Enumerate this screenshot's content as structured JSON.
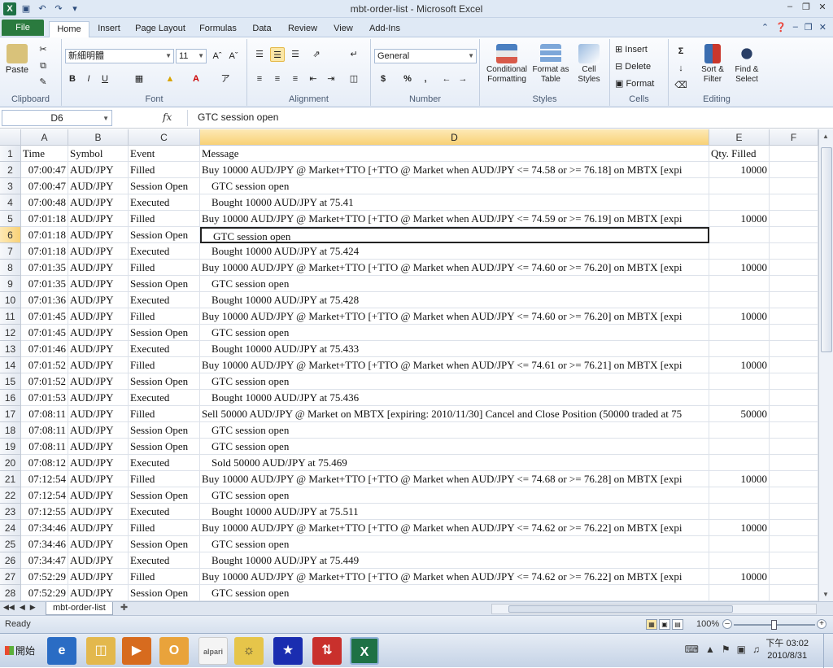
{
  "window": {
    "title": "mbt-order-list - Microsoft Excel"
  },
  "ribbon_tabs": [
    "File",
    "Home",
    "Insert",
    "Page Layout",
    "Formulas",
    "Data",
    "Review",
    "View",
    "Add-Ins"
  ],
  "ribbon": {
    "clipboard": {
      "paste": "Paste",
      "group": "Clipboard"
    },
    "font": {
      "name": "新細明體",
      "size": "11",
      "group": "Font",
      "bold": "B",
      "italic": "I",
      "underline": "U"
    },
    "alignment": {
      "group": "Alignment"
    },
    "number": {
      "format": "General",
      "group": "Number",
      "currency": "$",
      "percent": "%",
      "comma": ","
    },
    "styles": {
      "conditional": "Conditional Formatting",
      "format_table": "Format as Table",
      "cell_styles": "Cell Styles",
      "group": "Styles"
    },
    "cells": {
      "insert": "Insert",
      "delete": "Delete",
      "format": "Format",
      "group": "Cells"
    },
    "editing": {
      "sort": "Sort & Filter",
      "find": "Find & Select",
      "group": "Editing"
    }
  },
  "formula_bar": {
    "name_box": "D6",
    "fx": "fx",
    "formula": "GTC session open"
  },
  "columns": [
    "A",
    "B",
    "C",
    "D",
    "E",
    "F"
  ],
  "rows": [
    {
      "n": "1",
      "a": "Time",
      "b": "Symbol",
      "c": "Event",
      "d": "Message",
      "e": "Qty. Filled",
      "header": true
    },
    {
      "n": "2",
      "a": "07:00:47",
      "b": "AUD/JPY",
      "c": "Filled",
      "d": "Buy 10000 AUD/JPY @ Market+TTO [+TTO @ Market when AUD/JPY <= 74.58 or >= 76.18] on MBTX [expi",
      "e": "10000"
    },
    {
      "n": "3",
      "a": "07:00:47",
      "b": "AUD/JPY",
      "c": "Session Open",
      "d": "GTC session open",
      "e": "",
      "indent": true
    },
    {
      "n": "4",
      "a": "07:00:48",
      "b": "AUD/JPY",
      "c": "Executed",
      "d": "Bought 10000 AUD/JPY at 75.41",
      "e": "",
      "indent": true
    },
    {
      "n": "5",
      "a": "07:01:18",
      "b": "AUD/JPY",
      "c": "Filled",
      "d": "Buy 10000 AUD/JPY @ Market+TTO [+TTO @ Market when AUD/JPY <= 74.59 or >= 76.19] on MBTX [expi",
      "e": "10000"
    },
    {
      "n": "6",
      "a": "07:01:18",
      "b": "AUD/JPY",
      "c": "Session Open",
      "d": "GTC session open",
      "e": "",
      "indent": true,
      "active": true
    },
    {
      "n": "7",
      "a": "07:01:18",
      "b": "AUD/JPY",
      "c": "Executed",
      "d": "Bought 10000 AUD/JPY at 75.424",
      "e": "",
      "indent": true
    },
    {
      "n": "8",
      "a": "07:01:35",
      "b": "AUD/JPY",
      "c": "Filled",
      "d": "Buy 10000 AUD/JPY @ Market+TTO [+TTO @ Market when AUD/JPY <= 74.60 or >= 76.20] on MBTX [expi",
      "e": "10000"
    },
    {
      "n": "9",
      "a": "07:01:35",
      "b": "AUD/JPY",
      "c": "Session Open",
      "d": "GTC session open",
      "e": "",
      "indent": true
    },
    {
      "n": "10",
      "a": "07:01:36",
      "b": "AUD/JPY",
      "c": "Executed",
      "d": "Bought 10000 AUD/JPY at 75.428",
      "e": "",
      "indent": true
    },
    {
      "n": "11",
      "a": "07:01:45",
      "b": "AUD/JPY",
      "c": "Filled",
      "d": "Buy 10000 AUD/JPY @ Market+TTO [+TTO @ Market when AUD/JPY <= 74.60 or >= 76.20] on MBTX [expi",
      "e": "10000"
    },
    {
      "n": "12",
      "a": "07:01:45",
      "b": "AUD/JPY",
      "c": "Session Open",
      "d": "GTC session open",
      "e": "",
      "indent": true
    },
    {
      "n": "13",
      "a": "07:01:46",
      "b": "AUD/JPY",
      "c": "Executed",
      "d": "Bought 10000 AUD/JPY at 75.433",
      "e": "",
      "indent": true
    },
    {
      "n": "14",
      "a": "07:01:52",
      "b": "AUD/JPY",
      "c": "Filled",
      "d": "Buy 10000 AUD/JPY @ Market+TTO [+TTO @ Market when AUD/JPY <= 74.61 or >= 76.21] on MBTX [expi",
      "e": "10000"
    },
    {
      "n": "15",
      "a": "07:01:52",
      "b": "AUD/JPY",
      "c": "Session Open",
      "d": "GTC session open",
      "e": "",
      "indent": true
    },
    {
      "n": "16",
      "a": "07:01:53",
      "b": "AUD/JPY",
      "c": "Executed",
      "d": "Bought 10000 AUD/JPY at 75.436",
      "e": "",
      "indent": true
    },
    {
      "n": "17",
      "a": "07:08:11",
      "b": "AUD/JPY",
      "c": "Filled",
      "d": "Sell 50000 AUD/JPY @ Market on MBTX [expiring: 2010/11/30] Cancel and Close Position (50000 traded at 75",
      "e": "50000"
    },
    {
      "n": "18",
      "a": "07:08:11",
      "b": "AUD/JPY",
      "c": "Session Open",
      "d": "GTC session open",
      "e": "",
      "indent": true
    },
    {
      "n": "19",
      "a": "07:08:11",
      "b": "AUD/JPY",
      "c": "Session Open",
      "d": "GTC session open",
      "e": "",
      "indent": true
    },
    {
      "n": "20",
      "a": "07:08:12",
      "b": "AUD/JPY",
      "c": "Executed",
      "d": "Sold 50000 AUD/JPY at 75.469",
      "e": "",
      "indent": true
    },
    {
      "n": "21",
      "a": "07:12:54",
      "b": "AUD/JPY",
      "c": "Filled",
      "d": "Buy 10000 AUD/JPY @ Market+TTO [+TTO @ Market when AUD/JPY <= 74.68 or >= 76.28] on MBTX [expi",
      "e": "10000"
    },
    {
      "n": "22",
      "a": "07:12:54",
      "b": "AUD/JPY",
      "c": "Session Open",
      "d": "GTC session open",
      "e": "",
      "indent": true
    },
    {
      "n": "23",
      "a": "07:12:55",
      "b": "AUD/JPY",
      "c": "Executed",
      "d": "Bought 10000 AUD/JPY at 75.511",
      "e": "",
      "indent": true
    },
    {
      "n": "24",
      "a": "07:34:46",
      "b": "AUD/JPY",
      "c": "Filled",
      "d": "Buy 10000 AUD/JPY @ Market+TTO [+TTO @ Market when AUD/JPY <= 74.62 or >= 76.22] on MBTX [expi",
      "e": "10000"
    },
    {
      "n": "25",
      "a": "07:34:46",
      "b": "AUD/JPY",
      "c": "Session Open",
      "d": "GTC session open",
      "e": "",
      "indent": true
    },
    {
      "n": "26",
      "a": "07:34:47",
      "b": "AUD/JPY",
      "c": "Executed",
      "d": "Bought 10000 AUD/JPY at 75.449",
      "e": "",
      "indent": true
    },
    {
      "n": "27",
      "a": "07:52:29",
      "b": "AUD/JPY",
      "c": "Filled",
      "d": "Buy 10000 AUD/JPY @ Market+TTO [+TTO @ Market when AUD/JPY <= 74.62 or >= 76.22] on MBTX [expi",
      "e": "10000"
    },
    {
      "n": "28",
      "a": "07:52:29",
      "b": "AUD/JPY",
      "c": "Session Open",
      "d": "GTC session open",
      "e": "",
      "indent": true
    }
  ],
  "sheet_tab": "mbt-order-list",
  "status": {
    "text": "Ready",
    "zoom": "100%"
  },
  "taskbar": {
    "start": "開始",
    "clock_time": "下午 03:02",
    "clock_date": "2010/8/31",
    "apps": [
      "ie",
      "explorer",
      "media",
      "outlook",
      "alpari",
      "app5",
      "app6",
      "app7",
      "excel"
    ],
    "alpari_label": "alpari"
  }
}
